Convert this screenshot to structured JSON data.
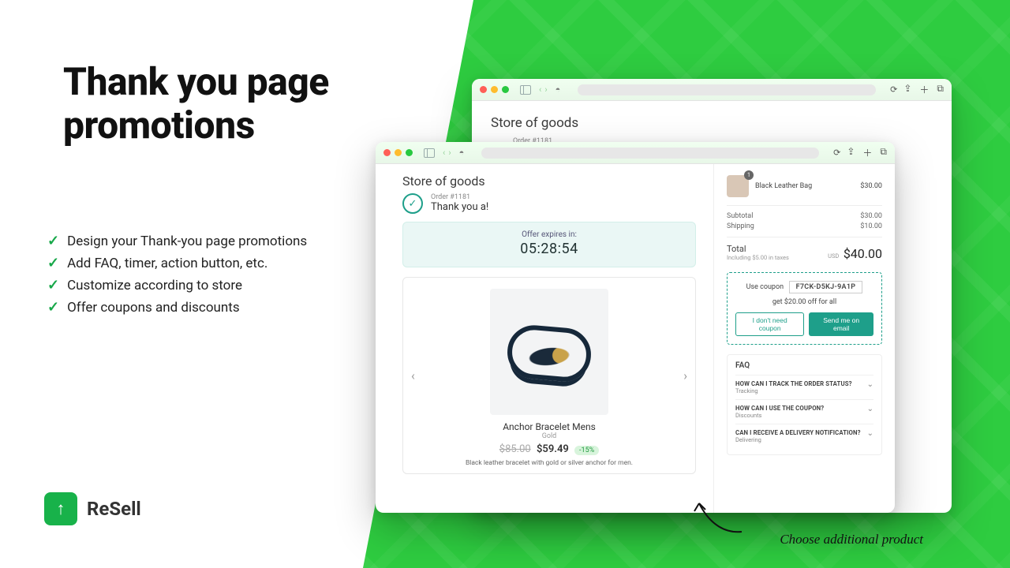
{
  "marketing": {
    "headline_l1": "Thank you page",
    "headline_l2": "promotions",
    "bullets": [
      "Design your Thank-you page promotions",
      "Add FAQ, timer, action button, etc.",
      "Customize according to store",
      "Offer coupons and discounts"
    ],
    "brand_name": "ReSell",
    "brand_glyph": "↑"
  },
  "back_window": {
    "store": "Store of goods",
    "order": "Order #1181"
  },
  "front_window": {
    "store": "Store of goods",
    "order_num": "Order #1181",
    "thanks": "Thank you a!",
    "offer_label": "Offer expires in:",
    "offer_timer": "05:28:54",
    "product": {
      "title": "Anchor Bracelet Mens",
      "subtitle": "Gold",
      "price_old": "$85.00",
      "price_new": "$59.49",
      "discount": "-15%",
      "desc": "Black leather bracelet with gold or silver anchor for men."
    },
    "summary": {
      "cart_item_name": "Black Leather Bag",
      "cart_item_qty": "1",
      "cart_item_price": "$30.00",
      "subtotal_label": "Subtotal",
      "subtotal": "$30.00",
      "shipping_label": "Shipping",
      "shipping": "$10.00",
      "total_label": "Total",
      "tax_note": "Including $5.00 in taxes",
      "currency": "USD",
      "total": "$40.00"
    },
    "coupon": {
      "use": "Use coupon",
      "code": "F7CK-D5KJ-9A1P",
      "get": "get $20.00 off for all",
      "btn_ghost": "I don't need coupon",
      "btn_solid": "Send me on email"
    },
    "faq": {
      "heading": "FAQ",
      "items": [
        {
          "q": "HOW CAN I TRACK THE ORDER STATUS?",
          "a": "Tracking"
        },
        {
          "q": "HOW CAN I USE THE COUPON?",
          "a": "Discounts"
        },
        {
          "q": "CAN I RECEIVE A DELIVERY NOTIFICATION?",
          "a": "Delivering"
        }
      ]
    }
  },
  "footnote": "Choose additional product"
}
